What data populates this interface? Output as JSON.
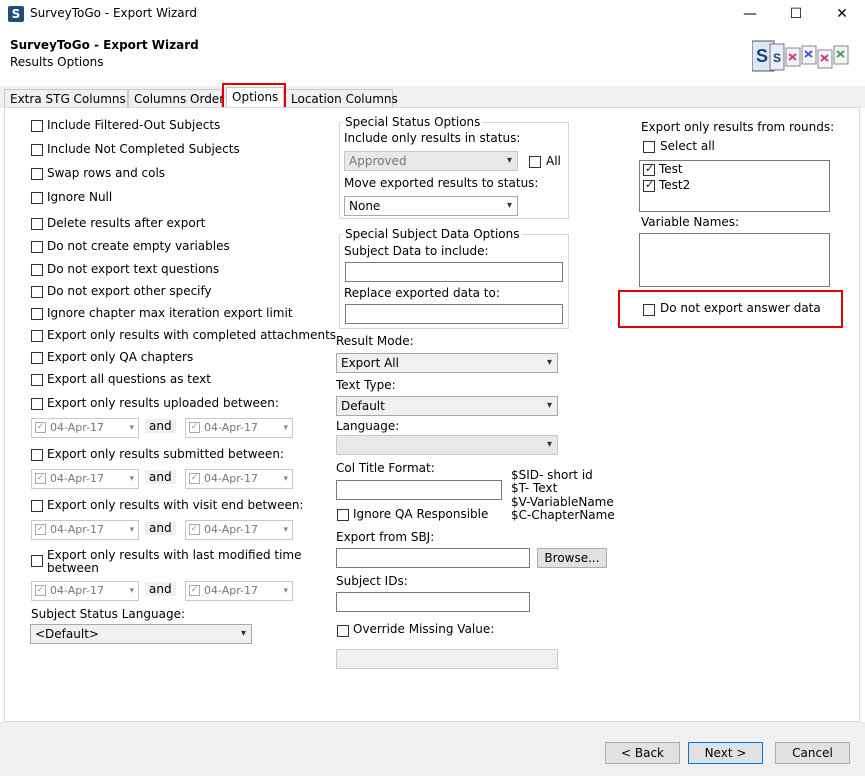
{
  "window": {
    "title": "SurveyToGo - Export Wizard",
    "app_icon_letter": "S",
    "minimize": "—",
    "maximize": "☐",
    "close": "✕"
  },
  "header": {
    "title": "SurveyToGo - Export Wizard",
    "subtitle": "Results Options"
  },
  "tabs": [
    {
      "label": "Extra STG Columns"
    },
    {
      "label": "Columns Order"
    },
    {
      "label": "Options",
      "active": true
    },
    {
      "label": "Location Columns"
    }
  ],
  "left_options": [
    "Include Filtered-Out Subjects",
    "Include Not Completed Subjects",
    "Swap rows and cols",
    "Ignore Null",
    "Delete results after export",
    "Do not create empty variables",
    "Do not export text questions",
    "Do not export other specify",
    "Ignore chapter max iteration export limit",
    "Export only results with completed attachments",
    "Export only QA chapters",
    "Export all questions as text"
  ],
  "date_filters": [
    {
      "label": "Export only results uploaded between:",
      "from": "04-Apr-17",
      "to": "04-Apr-17"
    },
    {
      "label": "Export only results submitted between:",
      "from": "04-Apr-17",
      "to": "04-Apr-17"
    },
    {
      "label": "Export only results with visit end between:",
      "from": "04-Apr-17",
      "to": "04-Apr-17"
    },
    {
      "label_line1": "Export only results with last modified time",
      "label_line2": "between",
      "from": "04-Apr-17",
      "to": "04-Apr-17"
    }
  ],
  "and_label": "and",
  "subject_status_language": {
    "label": "Subject Status Language:",
    "value": "<Default>"
  },
  "special_status": {
    "title": "Special Status Options",
    "include_label": "Include only results in status:",
    "include_value": "Approved",
    "all_label": "All",
    "move_label": "Move exported results to status:",
    "move_value": "None"
  },
  "special_subject": {
    "title": "Special Subject Data Options",
    "include_label": "Subject Data to include:",
    "replace_label": "Replace exported data to:"
  },
  "result_mode": {
    "label": "Result Mode:",
    "value": "Export All"
  },
  "text_type": {
    "label": "Text Type:",
    "value": "Default"
  },
  "language": {
    "label": "Language:",
    "value": ""
  },
  "col_title": {
    "label": "Col Title Format:",
    "hints": [
      "$SID- short id",
      "$T- Text",
      "$V-VariableName",
      "$C-ChapterName"
    ]
  },
  "ignore_qa_label": "Ignore QA Responsible",
  "export_from_sbj": {
    "label": "Export from SBJ:",
    "browse": "Browse..."
  },
  "subject_ids": {
    "label": "Subject IDs:"
  },
  "override_missing": {
    "label": "Override Missing Value:"
  },
  "rounds": {
    "label": "Export only results from rounds:",
    "select_all": "Select all",
    "items": [
      {
        "label": "Test",
        "checked": true
      },
      {
        "label": "Test2",
        "checked": true
      }
    ]
  },
  "variable_names": {
    "label": "Variable Names:"
  },
  "do_not_export_answer": "Do not export answer data",
  "buttons": {
    "back": "< Back",
    "next": "Next >",
    "cancel": "Cancel"
  },
  "check_mark": "✓",
  "arrow": "▾"
}
